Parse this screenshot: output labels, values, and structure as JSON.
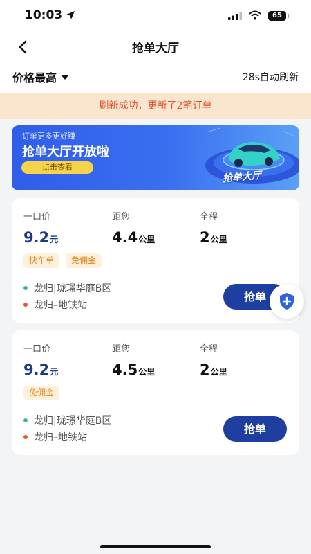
{
  "status_bar": {
    "time": "10:03",
    "battery": "65"
  },
  "nav": {
    "title": "抢单大厅"
  },
  "filter": {
    "sort_label": "价格最高",
    "refresh_note": "28s自动刷新"
  },
  "notice": {
    "text": "刷新成功，更新了2笔订单"
  },
  "banner": {
    "subtitle": "订单更多更好赚",
    "title": "抢单大厅开放啦",
    "button_label": "点击查看",
    "art_text": "抢单大厅"
  },
  "labels": {
    "price": "一口价",
    "distance": "距您",
    "total": "全程",
    "yuan": "元",
    "km": "公里"
  },
  "orders": [
    {
      "price": "9.2",
      "distance": "4.4",
      "total": "2",
      "tags": [
        "快车单",
        "免佣金"
      ],
      "from": "龙归|珑璟华庭B区",
      "to": "龙归–地铁站",
      "button": "抢单"
    },
    {
      "price": "9.2",
      "distance": "4.5",
      "total": "2",
      "tags": [
        "免佣金"
      ],
      "from": "龙归|珑璟华庭B区",
      "to": "龙归–地铁站",
      "button": "抢单"
    }
  ],
  "colors": {
    "accent": "#1e3fa0",
    "notice_bg": "#fae6cf",
    "notice_text": "#e0542b",
    "tag_text": "#e08a1e"
  }
}
